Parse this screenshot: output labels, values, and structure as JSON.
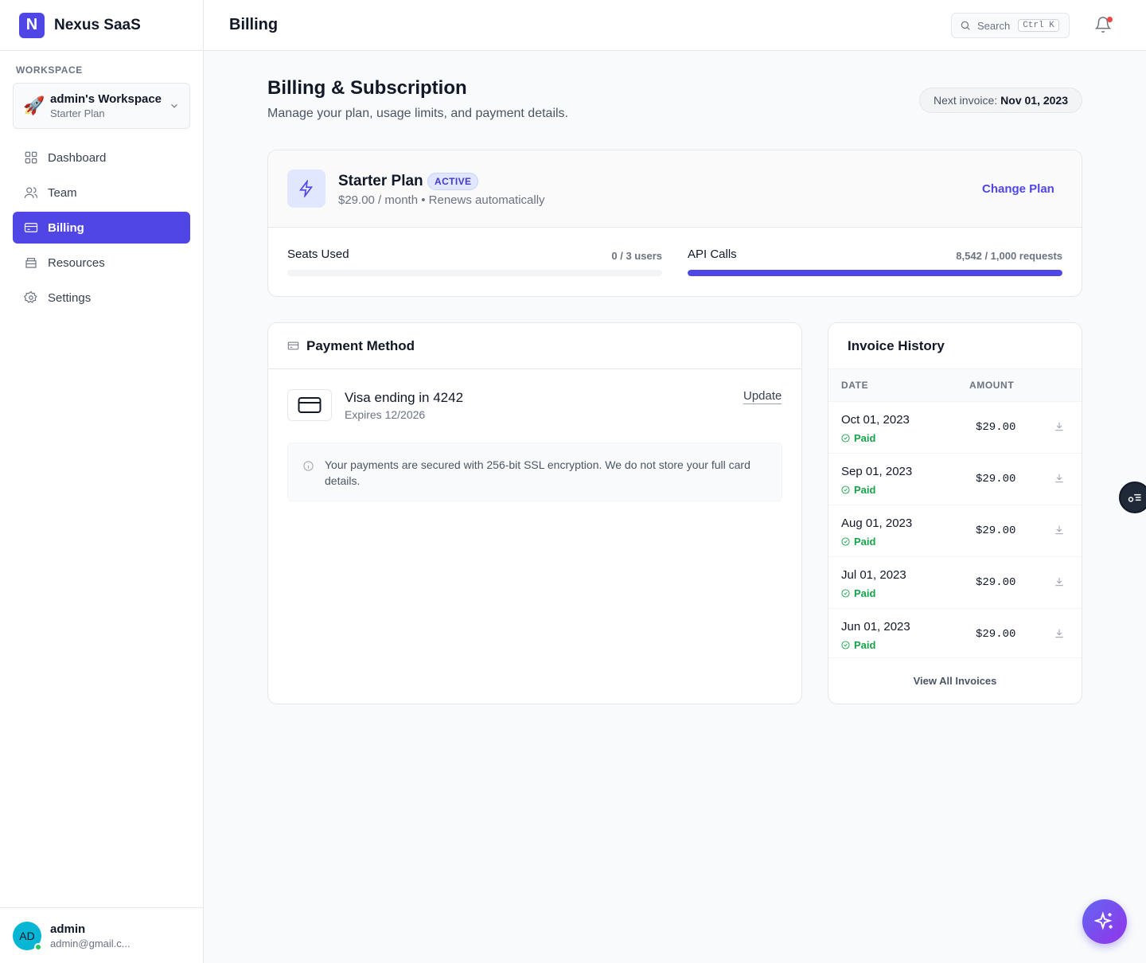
{
  "brand": {
    "logo_letter": "N",
    "name": "Nexus SaaS"
  },
  "workspace": {
    "section_label": "WORKSPACE",
    "emoji": "🚀",
    "name": "admin's Workspace",
    "plan": "Starter Plan"
  },
  "sidebar": {
    "items": [
      {
        "label": "Dashboard",
        "icon": "grid-icon"
      },
      {
        "label": "Team",
        "icon": "users-icon"
      },
      {
        "label": "Billing",
        "icon": "credit-card-icon",
        "active": true
      },
      {
        "label": "Resources",
        "icon": "box-icon"
      },
      {
        "label": "Settings",
        "icon": "gear-icon"
      }
    ]
  },
  "user": {
    "initials": "AD",
    "name": "admin",
    "email": "admin@gmail.c..."
  },
  "topbar": {
    "title": "Billing",
    "search_label": "Search",
    "search_shortcut": "Ctrl K"
  },
  "header": {
    "title": "Billing & Subscription",
    "subtitle": "Manage your plan, usage limits, and payment details.",
    "next_invoice_label": "Next invoice:",
    "next_invoice_date": "Nov 01, 2023"
  },
  "plan": {
    "name": "Starter Plan",
    "status": "ACTIVE",
    "price_line": "$29.00 / month • Renews automatically",
    "change_label": "Change Plan"
  },
  "usage": [
    {
      "label": "Seats Used",
      "value_text": "0 / 3 users",
      "fill_fraction": 0.0
    },
    {
      "label": "API Calls",
      "value_text": "8,542 / 1,000 requests",
      "fill_fraction": 1.0
    }
  ],
  "payment": {
    "title": "Payment Method",
    "card_name": "Visa ending in 4242",
    "card_expiry": "Expires 12/2026",
    "update_label": "Update",
    "security_note": "Your payments are secured with 256-bit SSL encryption. We do not store your full card details."
  },
  "invoices": {
    "title": "Invoice History",
    "col_date": "DATE",
    "col_amount": "AMOUNT",
    "rows": [
      {
        "date": "Oct 01, 2023",
        "status": "Paid",
        "amount": "$29.00"
      },
      {
        "date": "Sep 01, 2023",
        "status": "Paid",
        "amount": "$29.00"
      },
      {
        "date": "Aug 01, 2023",
        "status": "Paid",
        "amount": "$29.00"
      },
      {
        "date": "Jul 01, 2023",
        "status": "Paid",
        "amount": "$29.00"
      },
      {
        "date": "Jun 01, 2023",
        "status": "Paid",
        "amount": "$29.00"
      }
    ],
    "view_all_label": "View All Invoices"
  },
  "colors": {
    "accent": "#4f46e5",
    "success": "#16a34a",
    "notification": "#ef4444"
  }
}
